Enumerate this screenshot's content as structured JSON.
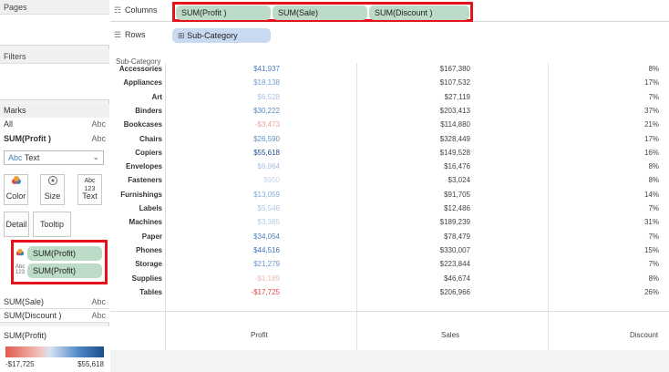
{
  "left_panel": {
    "pages_title": "Pages",
    "filters_title": "Filters",
    "marks": {
      "title": "Marks",
      "rows": [
        {
          "label": "All",
          "type": "Abc"
        },
        {
          "label": "SUM(Profit )",
          "type": "Abc"
        }
      ],
      "mark_type": "Text",
      "mark_type_prefix": "Abc",
      "buttons": [
        {
          "label": "Color",
          "icon": "color-icon"
        },
        {
          "label": "Size",
          "icon": "size-icon"
        },
        {
          "label": "Text",
          "icon": "text-icon"
        }
      ],
      "buttons2": [
        "Detail",
        "Tooltip"
      ],
      "encodings": [
        {
          "label": "SUM(Profit)",
          "icon": "color-icon"
        },
        {
          "label": "SUM(Profit)",
          "icon": "text-icon"
        }
      ]
    },
    "measure_cards": [
      {
        "label": "SUM(Sale)",
        "type": "Abc"
      },
      {
        "label": "SUM(Discount )",
        "type": "Abc"
      }
    ],
    "legend": {
      "title": "SUM(Profit)",
      "min": "-$17,725",
      "max": "$55,618"
    }
  },
  "shelves": {
    "columns_label": "Columns",
    "columns_pills": [
      "SUM(Profit )",
      "SUM(Sale)",
      "SUM(Discount )"
    ],
    "rows_label": "Rows",
    "rows_pills": [
      "Sub-Category"
    ]
  },
  "view": {
    "row_header": "Sub-Category",
    "column_labels": [
      "Profit",
      "Sales",
      "Discount"
    ],
    "rows": [
      {
        "name": "Accessories",
        "profit": "$41,937",
        "sales": "$167,380",
        "discount": "8%",
        "profit_color": "#4a7fbd"
      },
      {
        "name": "Appliances",
        "profit": "$18,138",
        "sales": "$107,532",
        "discount": "17%",
        "profit_color": "#6f9bd0"
      },
      {
        "name": "Art",
        "profit": "$6,528",
        "sales": "$27,119",
        "discount": "7%",
        "profit_color": "#a9c3e6"
      },
      {
        "name": "Binders",
        "profit": "$30,222",
        "sales": "$203,413",
        "discount": "37%",
        "profit_color": "#5687c3"
      },
      {
        "name": "Bookcases",
        "profit": "-$3,473",
        "sales": "$114,880",
        "discount": "21%",
        "profit_color": "#eba59c"
      },
      {
        "name": "Chairs",
        "profit": "$26,590",
        "sales": "$328,449",
        "discount": "17%",
        "profit_color": "#5f8fc7"
      },
      {
        "name": "Copiers",
        "profit": "$55,618",
        "sales": "$149,528",
        "discount": "16%",
        "profit_color": "#1f4f8c"
      },
      {
        "name": "Envelopes",
        "profit": "$6,964",
        "sales": "$16,476",
        "discount": "8%",
        "profit_color": "#a6c1e5"
      },
      {
        "name": "Fasteners",
        "profit": "$950",
        "sales": "$3,024",
        "discount": "8%",
        "profit_color": "#c5d6ee"
      },
      {
        "name": "Furnishings",
        "profit": "$13,059",
        "sales": "$91,705",
        "discount": "14%",
        "profit_color": "#83a9d8"
      },
      {
        "name": "Labels",
        "profit": "$5,546",
        "sales": "$12,486",
        "discount": "7%",
        "profit_color": "#abc5e6"
      },
      {
        "name": "Machines",
        "profit": "$3,385",
        "sales": "$189,239",
        "discount": "31%",
        "profit_color": "#b3cae8"
      },
      {
        "name": "Paper",
        "profit": "$34,054",
        "sales": "$78,479",
        "discount": "7%",
        "profit_color": "#4f83c1"
      },
      {
        "name": "Phones",
        "profit": "$44,516",
        "sales": "$330,007",
        "discount": "15%",
        "profit_color": "#3d74b6"
      },
      {
        "name": "Storage",
        "profit": "$21,279",
        "sales": "$223,844",
        "discount": "7%",
        "profit_color": "#6995cd"
      },
      {
        "name": "Supplies",
        "profit": "-$1,189",
        "sales": "$46,674",
        "discount": "8%",
        "profit_color": "#f0b9b1"
      },
      {
        "name": "Tables",
        "profit": "-$17,725",
        "sales": "$206,966",
        "discount": "26%",
        "profit_color": "#e0493e"
      }
    ]
  },
  "colors": {
    "highlight_red": "#e3121b",
    "pill_green": "#bcdcc7",
    "pill_blue": "#c9d9f1"
  }
}
